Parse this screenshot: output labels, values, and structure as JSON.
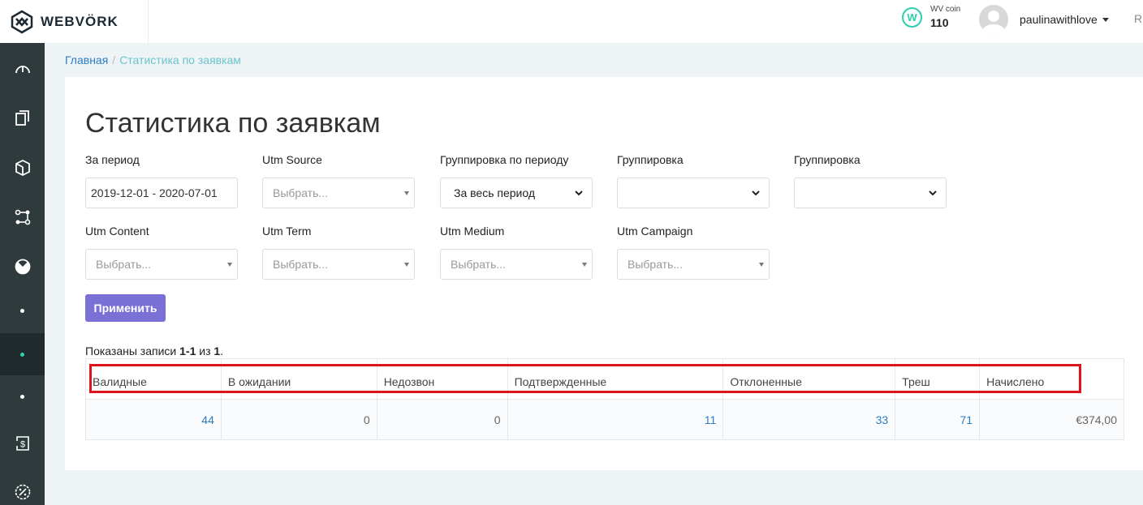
{
  "header": {
    "logo_text": "WEBVÖRK",
    "coin_label": "WV coin",
    "coin_value": "110",
    "coin_icon_letter": "W",
    "username": "paulinawithlove",
    "lang": "R"
  },
  "sidebar": {
    "items": [
      {
        "icon": "dashboard-icon"
      },
      {
        "icon": "documents-icon"
      },
      {
        "icon": "cube-icon"
      },
      {
        "icon": "network-icon"
      },
      {
        "icon": "chart-pie-icon"
      },
      {
        "icon": "dot"
      },
      {
        "icon": "dot",
        "active": true
      },
      {
        "icon": "dot"
      },
      {
        "icon": "dollar-icon"
      },
      {
        "icon": "percent-icon"
      }
    ]
  },
  "breadcrumb": {
    "home": "Главная",
    "separator": "/",
    "current": "Статистика по заявкам"
  },
  "page": {
    "title": "Статистика по заявкам"
  },
  "filters": {
    "period": {
      "label": "За период",
      "value": "2019-12-01 - 2020-07-01"
    },
    "utm_source": {
      "label": "Utm Source",
      "placeholder": "Выбрать..."
    },
    "group_by_period": {
      "label": "Группировка по периоду",
      "value": "За весь период"
    },
    "grouping1": {
      "label": "Группировка",
      "value": ""
    },
    "grouping2": {
      "label": "Группировка",
      "value": ""
    },
    "utm_content": {
      "label": "Utm Content",
      "placeholder": "Выбрать..."
    },
    "utm_term": {
      "label": "Utm Term",
      "placeholder": "Выбрать..."
    },
    "utm_medium": {
      "label": "Utm Medium",
      "placeholder": "Выбрать..."
    },
    "utm_campaign": {
      "label": "Utm Campaign",
      "placeholder": "Выбрать..."
    },
    "apply_label": "Применить"
  },
  "summary": {
    "prefix": "Показаны записи ",
    "range": "1-1",
    "middle": " из ",
    "total": "1",
    "suffix": "."
  },
  "table": {
    "headers": [
      "Валидные",
      "В ожидании",
      "Недозвон",
      "Подтвержденные",
      "Отклоненные",
      "Треш",
      "Начислено"
    ],
    "row": [
      "44",
      "0",
      "0",
      "11",
      "33",
      "71",
      "€374,00"
    ]
  },
  "colors": {
    "accent": "#7b70d6",
    "sidebar": "#2f3a3d",
    "link": "#2c7cc4",
    "highlight": "#e0121a",
    "teal": "#2ecfb0"
  }
}
